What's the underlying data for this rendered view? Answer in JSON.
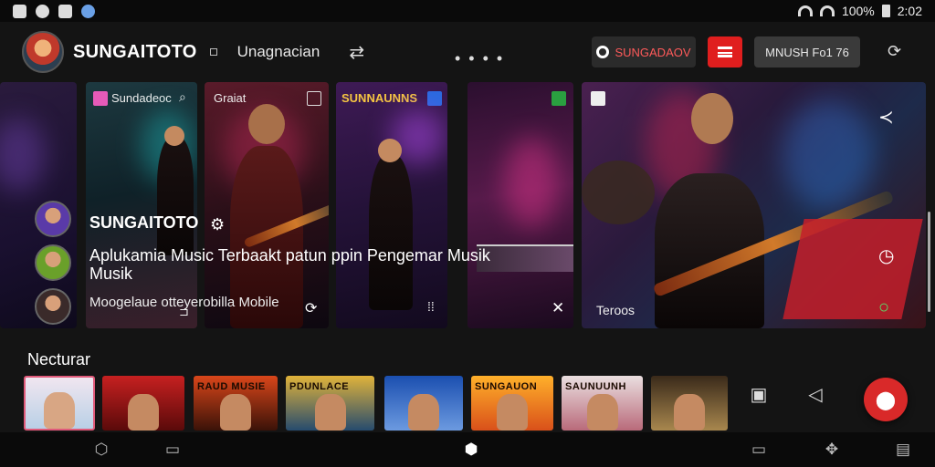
{
  "status_bar": {
    "battery_text": "100%",
    "time": "2:02"
  },
  "header": {
    "brand": "SUNGAITOTO",
    "subtitle": "Unagnacian",
    "dots": "• • • •",
    "btn_dark_label": "SUNGADAOV",
    "btn_gray_label": "MNUSH Fo1 76"
  },
  "cards": [
    {
      "title": ""
    },
    {
      "title": "Sundadeoc"
    },
    {
      "title": "Graiat"
    },
    {
      "title": "SUNNAUNNS"
    },
    {
      "title": ""
    },
    {
      "title": "",
      "footer": "Teroos"
    }
  ],
  "overlay": {
    "title": "SUNGAITOTO",
    "description": "Aplukamia Music Terbaakt patun ppin Pengemar Musik Musik",
    "subtitle": "Moogelaue otteyerobilla Mobile"
  },
  "featured": {
    "label": "Necturar",
    "thumbs": [
      {
        "label": ""
      },
      {
        "label": ""
      },
      {
        "label": "RAUD MUSIE"
      },
      {
        "label": "PDUNLACE"
      },
      {
        "label": ""
      },
      {
        "label": "SUNGAUON"
      },
      {
        "label": "SAUNUUNH"
      },
      {
        "label": ""
      }
    ]
  },
  "colors": {
    "accent_red": "#e01e1e",
    "background": "#141414"
  }
}
